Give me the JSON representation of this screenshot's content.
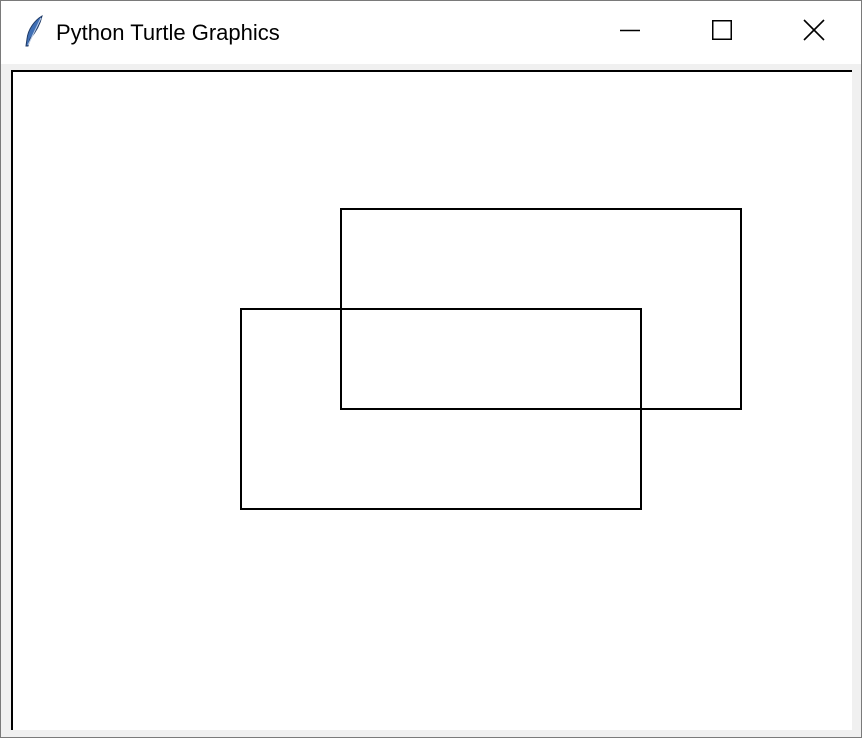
{
  "window": {
    "title": "Python Turtle Graphics",
    "app_icon": "feather-icon",
    "controls": {
      "minimize_icon": "minimize-icon",
      "maximize_icon": "maximize-icon",
      "close_icon": "close-icon"
    }
  },
  "canvas": {
    "background": "#ffffff",
    "stroke_color": "#000000",
    "shapes": [
      {
        "kind": "rectangle",
        "name": "rectangle-upper-right"
      },
      {
        "kind": "rectangle",
        "name": "rectangle-lower-left"
      }
    ]
  }
}
